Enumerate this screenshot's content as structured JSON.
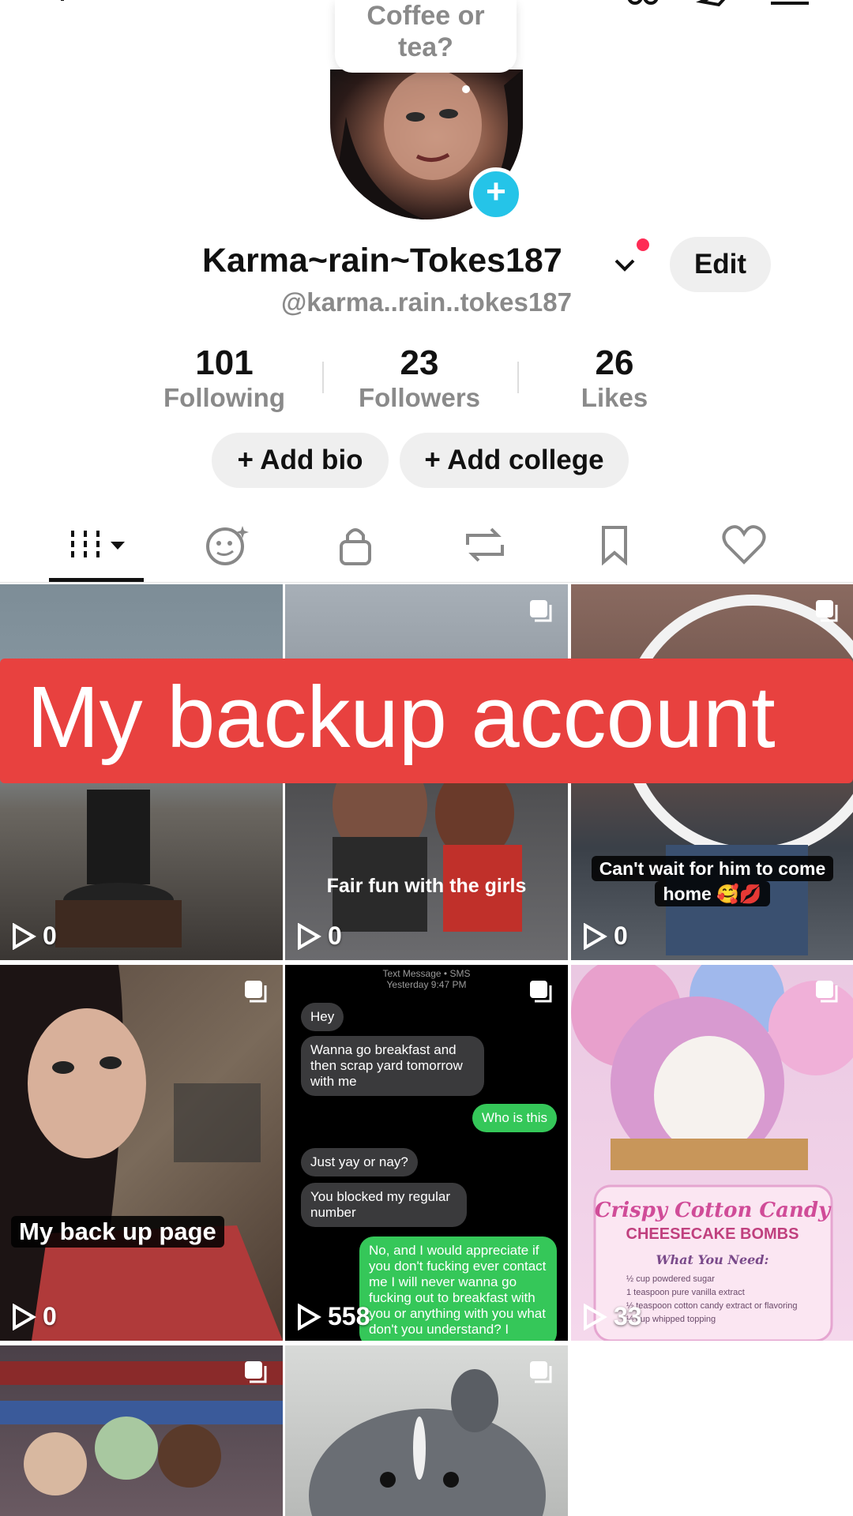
{
  "profile_bubble": {
    "line1": "Coffee or",
    "line2": "tea?"
  },
  "profile": {
    "display_name": "Karma~rain~Tokes187",
    "handle": "@karma..rain..tokes187",
    "edit_label": "Edit"
  },
  "stats": [
    {
      "value": "101",
      "label": "Following"
    },
    {
      "value": "23",
      "label": "Followers"
    },
    {
      "value": "26",
      "label": "Likes"
    }
  ],
  "actions": {
    "add_bio": "+ Add bio",
    "add_college": "+ Add college"
  },
  "tabs": [
    "videos-tab",
    "ai-self-tab",
    "private-tab",
    "reposts-tab",
    "favorites-tab",
    "liked-tab"
  ],
  "banner": {
    "text": "My backup account",
    "color": "#e8413f"
  },
  "grid": [
    {
      "views": "0",
      "caption": ""
    },
    {
      "views": "0",
      "caption": "Fair fun with the girls"
    },
    {
      "views": "0",
      "caption_line1": "Can't wait for him to come",
      "caption_line2": "home 🥰💋"
    },
    {
      "views": "0",
      "caption": "My back up page"
    },
    {
      "views": "558",
      "sms_header1": "Text Message • SMS",
      "sms_header2": "Yesterday 9:47 PM",
      "messages": [
        {
          "dir": "in",
          "text": "Hey"
        },
        {
          "dir": "in",
          "text": "Wanna go breakfast and then scrap yard tomorrow with me"
        },
        {
          "dir": "out",
          "text": "Who is this"
        },
        {
          "dir": "in",
          "text": "Just yay or nay?"
        },
        {
          "dir": "in",
          "text": "You blocked my regular number"
        },
        {
          "dir": "out",
          "text": "No, and I would appreciate if you don't fucking ever contact me I will never wanna go fucking out to breakfast with you or anything with you what don't you understand? I"
        }
      ]
    },
    {
      "views": "33",
      "title1": "Crispy Cotton Candy",
      "title2": "CHEESECAKE BOMBS",
      "need": "What You Need:",
      "items": [
        "½ cup powdered sugar",
        "1 teaspoon pure vanilla extract",
        "½ teaspoon cotton candy extract or flavoring",
        "½ cup whipped topping"
      ]
    },
    {
      "views": ""
    },
    {
      "views": ""
    }
  ],
  "colors": {
    "accent_blue": "#25c4e8",
    "notification_red": "#fe2c55",
    "pill_bg": "#efefef",
    "muted_text": "#8a8a8a"
  }
}
